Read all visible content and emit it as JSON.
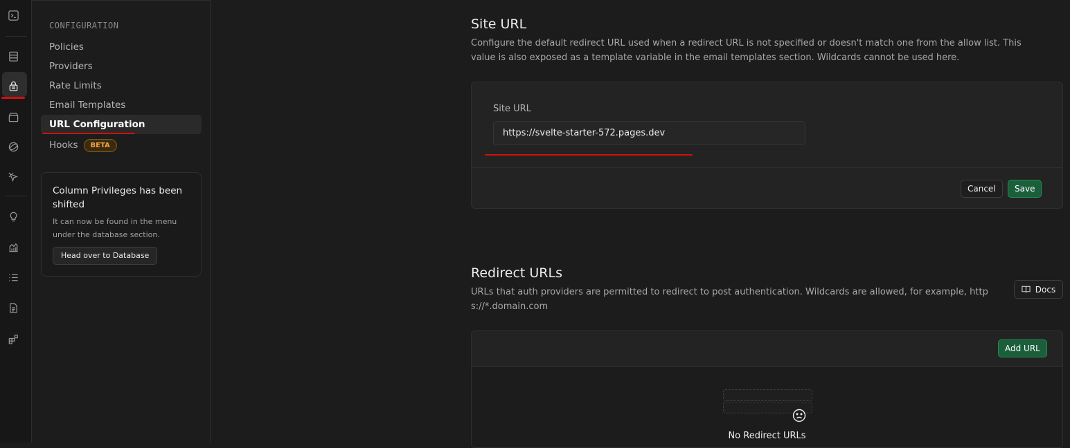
{
  "sidebar": {
    "section_title": "CONFIGURATION",
    "items": [
      {
        "label": "Policies"
      },
      {
        "label": "Providers"
      },
      {
        "label": "Rate Limits"
      },
      {
        "label": "Email Templates"
      },
      {
        "label": "URL Configuration",
        "active": true
      },
      {
        "label": "Hooks",
        "badge": "BETA"
      }
    ],
    "notice": {
      "title": "Column Privileges has been shifted",
      "body": "It can now be found in the menu under the database section.",
      "button": "Head over to Database"
    }
  },
  "rail_icons": [
    "terminal-icon",
    "database-icon",
    "auth-lock-icon",
    "storage-icon",
    "realtime-icon",
    "cursor-icon",
    "lightbulb-icon",
    "reports-icon",
    "logs-list-icon",
    "docs-icon",
    "integrations-icon"
  ],
  "site_url": {
    "title": "Site URL",
    "description": "Configure the default redirect URL used when a redirect URL is not specified or doesn't match one from the allow list. This value is also exposed as a template variable in the email templates section. Wildcards cannot be used here.",
    "field_label": "Site URL",
    "value": "https://svelte-starter-572.pages.dev",
    "cancel_label": "Cancel",
    "save_label": "Save"
  },
  "redirect_urls": {
    "title": "Redirect URLs",
    "description": "URLs that auth providers are permitted to redirect to post authentication. Wildcards are allowed, for example, https://*.domain.com",
    "docs_label": "Docs",
    "add_label": "Add URL",
    "empty_text": "No Redirect URLs"
  },
  "colors": {
    "background": "#1c1c1c",
    "accent_green": "#1a5e3a",
    "beta_orange": "#f0a43c",
    "annotation_red": "#d40f0f"
  }
}
